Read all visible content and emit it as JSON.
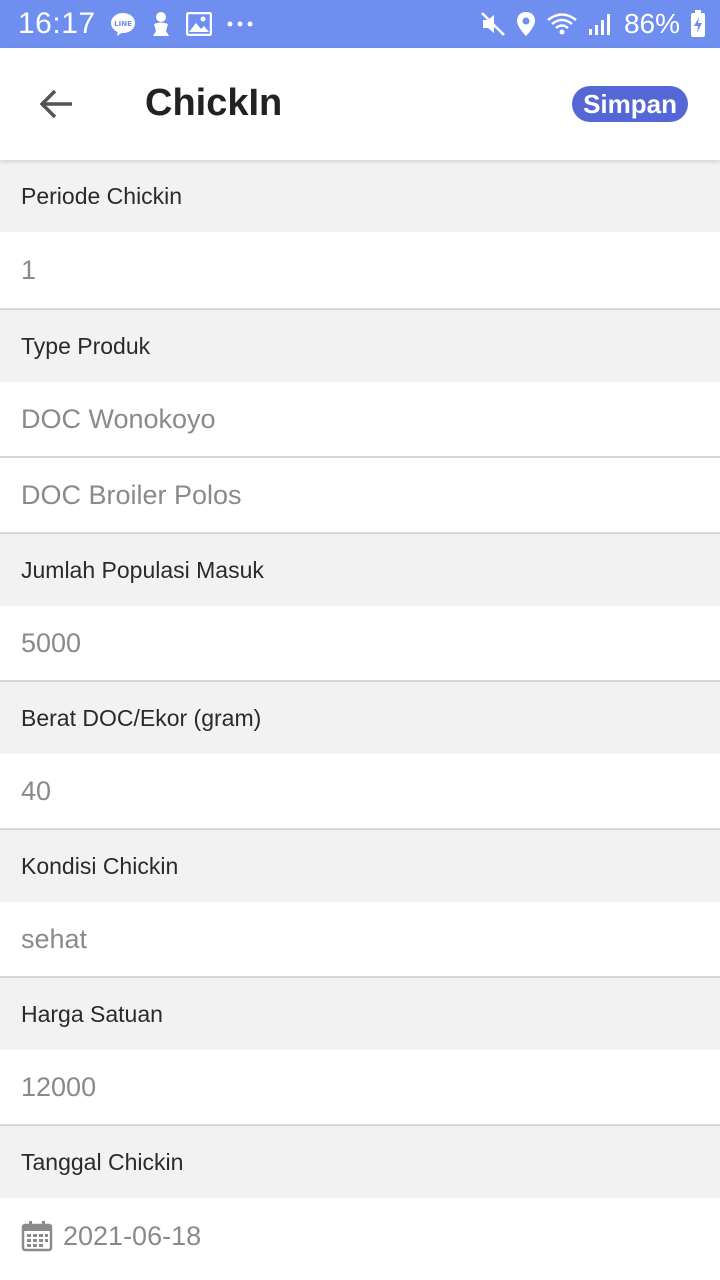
{
  "status_bar": {
    "time": "16:17",
    "battery": "86%",
    "left_icons": [
      "line-icon",
      "notification-person-icon",
      "image-icon",
      "more-dots-icon"
    ],
    "right_icons": [
      "mute-icon",
      "location-icon",
      "wifi-icon",
      "signal-icon",
      "battery-charging-icon"
    ]
  },
  "app_bar": {
    "title": "ChickIn",
    "save_label": "Simpan"
  },
  "form": {
    "periode_label": "Periode Chickin",
    "periode_value": "1",
    "type_label": "Type Produk",
    "type_value_1": "DOC Wonokoyo",
    "type_value_2": "DOC Broiler Polos",
    "populasi_label": "Jumlah Populasi Masuk",
    "populasi_value": "5000",
    "berat_label": "Berat DOC/Ekor (gram)",
    "berat_value": "40",
    "kondisi_label": "Kondisi Chickin",
    "kondisi_value": "sehat",
    "harga_label": "Harga Satuan",
    "harga_value": "12000",
    "tanggal_label": "Tanggal Chickin",
    "tanggal_value": "2021-06-18"
  },
  "colors": {
    "status_bar": "#6e8ef0",
    "accent": "#5566d6",
    "label_bg": "#f2f2f2"
  }
}
